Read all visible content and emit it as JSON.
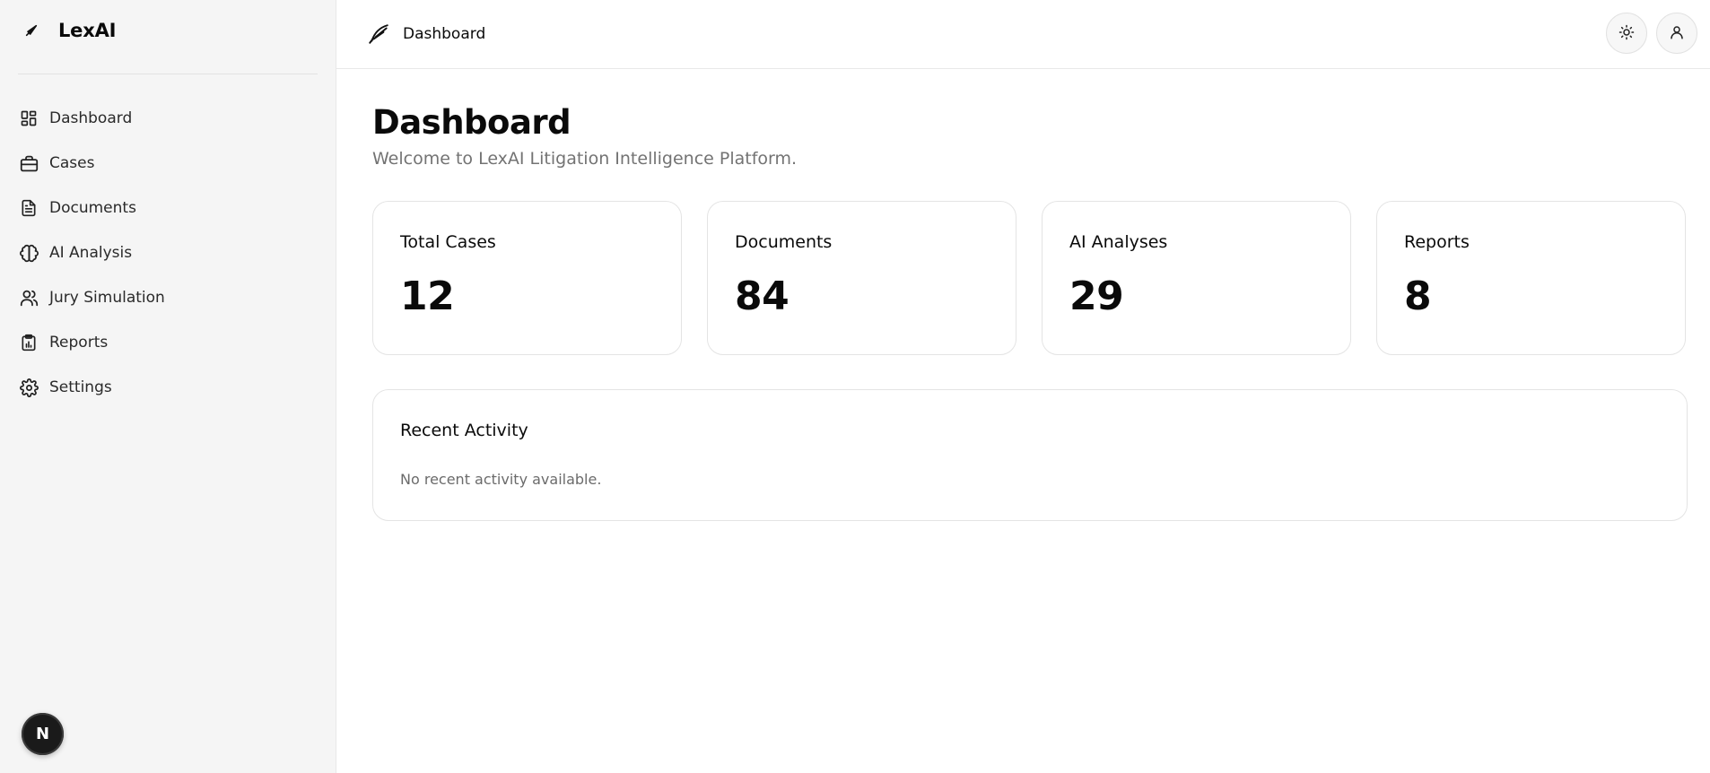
{
  "brand": {
    "name": "LexAI",
    "icon": "feather-icon"
  },
  "sidebar": {
    "items": [
      {
        "label": "Dashboard",
        "icon": "layout-dashboard-icon"
      },
      {
        "label": "Cases",
        "icon": "briefcase-icon"
      },
      {
        "label": "Documents",
        "icon": "file-text-icon"
      },
      {
        "label": "AI Analysis",
        "icon": "brain-icon"
      },
      {
        "label": "Jury Simulation",
        "icon": "users-icon"
      },
      {
        "label": "Reports",
        "icon": "clipboard-chart-icon"
      },
      {
        "label": "Settings",
        "icon": "gear-icon"
      }
    ],
    "badge_letter": "N"
  },
  "header": {
    "breadcrumb": "Dashboard",
    "icons": [
      "feather-icon",
      "sun-icon",
      "user-icon"
    ]
  },
  "main": {
    "title": "Dashboard",
    "subtitle": "Welcome to LexAI Litigation Intelligence Platform.",
    "stats": [
      {
        "label": "Total Cases",
        "value": "12"
      },
      {
        "label": "Documents",
        "value": "84"
      },
      {
        "label": "AI Analyses",
        "value": "29"
      },
      {
        "label": "Reports",
        "value": "8"
      }
    ],
    "recent_activity": {
      "title": "Recent Activity",
      "empty_text": "No recent activity available."
    }
  },
  "colors": {
    "sidebar_bg": "#f5f5f5",
    "text": "#0a0a0a",
    "muted": "#737373",
    "border": "#e4e4e4",
    "badge_bg": "#1a1a1a"
  }
}
